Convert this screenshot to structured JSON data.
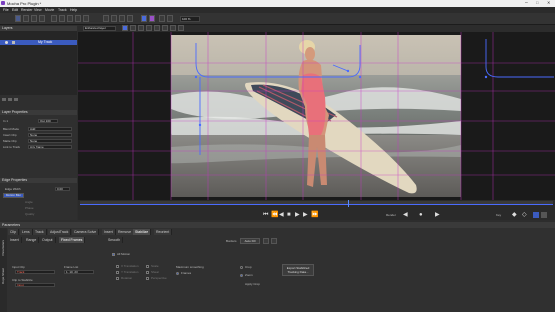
{
  "window": {
    "title": "Mocha Pro Plugin *"
  },
  "menu": {
    "items": [
      "File",
      "Edit",
      "Render",
      "View",
      "Movie",
      "Track",
      "Help"
    ]
  },
  "toolbar": {
    "zoom": "100 %",
    "clip_select": "Camera 1"
  },
  "viewer_toolbar": {
    "clip": "Enhanced layer",
    "view": "Layers",
    "layer_select": "Layer 1"
  },
  "layers_panel": {
    "title": "Layers",
    "layer_name": "My Track"
  },
  "layer_properties": {
    "title": "Layer Properties",
    "in_label": "In 1",
    "out_label": "Out 100",
    "blend_mode_label": "Blend Mode",
    "blend_mode_value": "Add",
    "insert_clip_label": "Insert Clip",
    "insert_clip_value": "None",
    "matte_clip_label": "Matte Clip",
    "matte_clip_value": "None",
    "link_to_track_label": "Link to Track",
    "link_to_track_value": "Any frame"
  },
  "edge_properties": {
    "title": "Edge Properties",
    "edge_width_label": "Edge Width",
    "edge_width_value": "0.00",
    "motion_blur_label": "Motion Blur",
    "angle_label": "Angle",
    "phase_label": "Phase",
    "quality_label": "Quality"
  },
  "timeline": {
    "render_label": "Render",
    "key_label": "Key"
  },
  "parameters": {
    "title": "Parameters",
    "tabs": [
      "Clip",
      "Lens",
      "Track",
      "AdjustTrack",
      "Camera Solve",
      "Insert",
      "Remove",
      "Stabilize",
      "Reorient"
    ],
    "subtabs": [
      "Insert",
      "Range",
      "Output",
      "Fixed Frames",
      "Smooth"
    ],
    "side_tabs": [
      "Parameters",
      "Dope Sheet"
    ],
    "all_motion_label": "All Motion",
    "input_clip_label": "Input Clip",
    "input_clip_value": "Track",
    "frame_list_label": "Frame List",
    "frame_list_value": "1, 10, 23",
    "clip_stabilize_label": "Clip to Stabilize",
    "clip_stabilize_value": "Input",
    "motion_options": [
      "X Translation",
      "Y Translation",
      "Rotation",
      "Scale",
      "Shear",
      "Perspective"
    ],
    "maximum_smoothing_label": "Maximum smoothing",
    "frames_label": "Frames",
    "borders_label": "Borders",
    "borders_value": "Auto Fill",
    "borders_options": [
      "Crop",
      "Zoom",
      "Apply Crop"
    ],
    "export_btn": "Export Stabilized Tracking Data..."
  },
  "colors": {
    "accent": "#5a5aff",
    "selection": "#3b5bbf",
    "grid": "#c832c8",
    "track_line": "#4a6bff"
  }
}
